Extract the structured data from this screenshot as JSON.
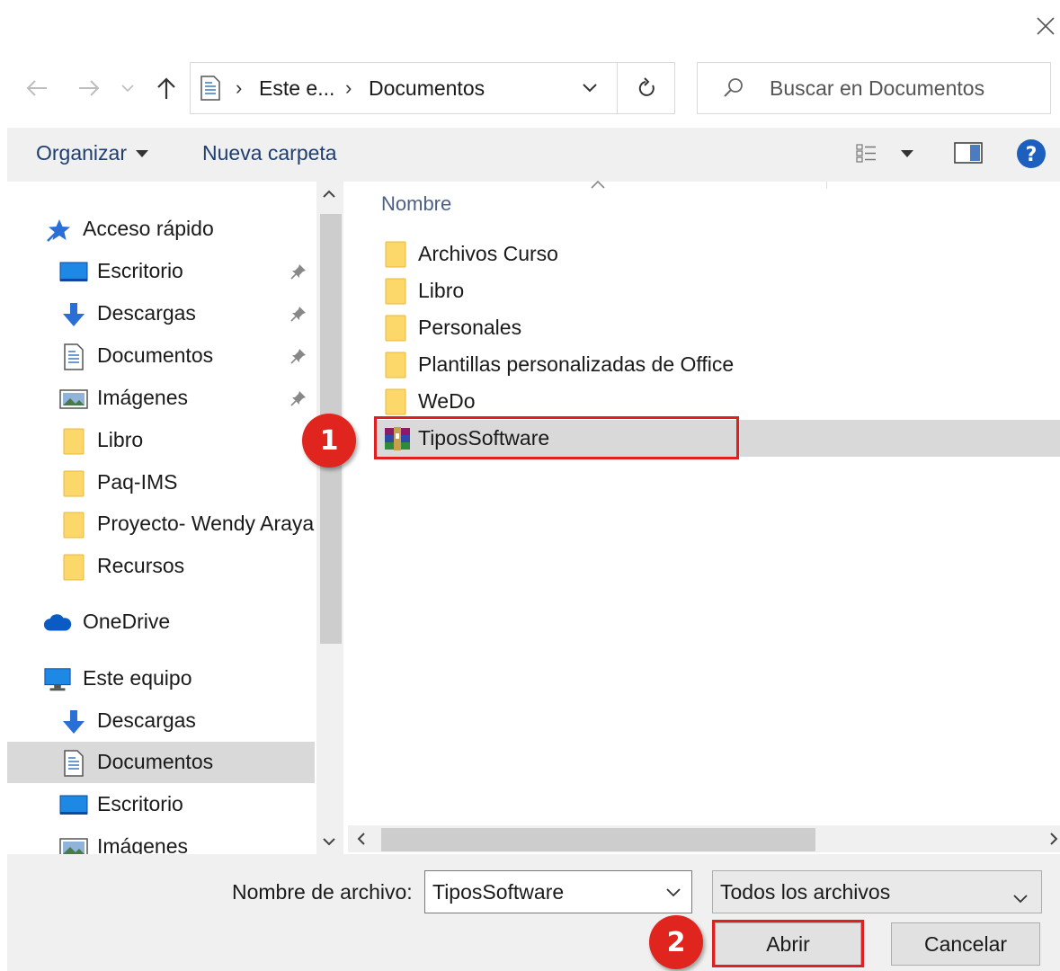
{
  "window": {
    "close_glyph": "✕"
  },
  "address_bar": {
    "segments": [
      "Este e...",
      "Documentos"
    ],
    "separator": "›"
  },
  "search": {
    "placeholder": "Buscar en Documentos"
  },
  "toolbar": {
    "organize_label": "Organizar",
    "new_folder_label": "Nueva carpeta",
    "help_glyph": "?"
  },
  "nav_pane": {
    "items": [
      {
        "label": "Acceso rápido",
        "icon": "quick-access-star-icon",
        "pinned": false
      },
      {
        "label": "Escritorio",
        "icon": "desktop-icon",
        "pinned": true
      },
      {
        "label": "Descargas",
        "icon": "download-arrow-icon",
        "pinned": true
      },
      {
        "label": "Documentos",
        "icon": "document-icon",
        "pinned": true
      },
      {
        "label": "Imágenes",
        "icon": "pictures-icon",
        "pinned": true
      },
      {
        "label": "Libro",
        "icon": "folder-icon",
        "pinned": false
      },
      {
        "label": "Paq-IMS",
        "icon": "folder-icon",
        "pinned": false
      },
      {
        "label": "Proyecto- Wendy Araya",
        "icon": "folder-icon",
        "pinned": false
      },
      {
        "label": "Recursos",
        "icon": "folder-icon",
        "pinned": false
      },
      {
        "label": "OneDrive",
        "icon": "cloud-icon",
        "pinned": false
      },
      {
        "label": "Este equipo",
        "icon": "computer-icon",
        "pinned": false
      },
      {
        "label": "Descargas",
        "icon": "download-arrow-icon",
        "pinned": false
      },
      {
        "label": "Documentos",
        "icon": "document-icon",
        "pinned": false,
        "selected": true
      },
      {
        "label": "Escritorio",
        "icon": "desktop-icon",
        "pinned": false
      },
      {
        "label": "Imágenes",
        "icon": "pictures-icon",
        "pinned": false
      }
    ]
  },
  "file_list": {
    "column_header": "Nombre",
    "items": [
      {
        "name": "Archivos Curso",
        "icon": "folder-icon"
      },
      {
        "name": "Libro",
        "icon": "folder-icon"
      },
      {
        "name": "Personales",
        "icon": "folder-icon"
      },
      {
        "name": "Plantillas personalizadas de Office",
        "icon": "folder-icon"
      },
      {
        "name": "WeDo",
        "icon": "folder-icon"
      },
      {
        "name": "TiposSoftware",
        "icon": "winrar-archive-icon",
        "selected": true
      }
    ]
  },
  "bottom": {
    "filename_label": "Nombre de archivo:",
    "filename_value": "TiposSoftware",
    "filetype_value": "Todos los archivos",
    "open_label": "Abrir",
    "cancel_label": "Cancelar"
  },
  "annotations": {
    "step1": "1",
    "step2": "2",
    "color": "#e02020"
  }
}
